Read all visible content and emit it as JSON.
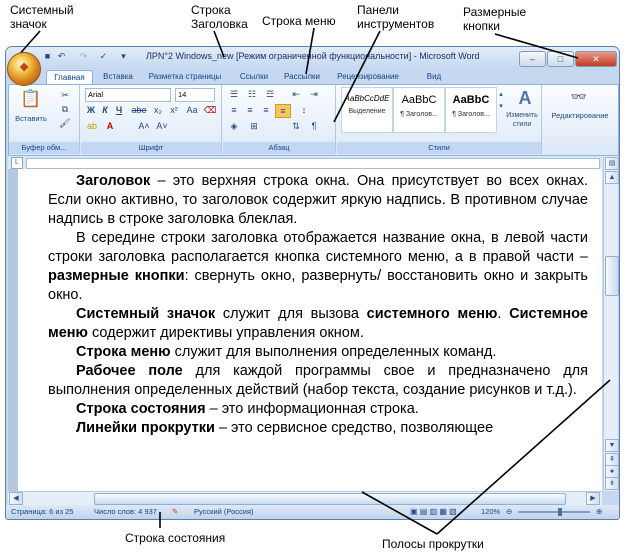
{
  "callouts": {
    "system_icon": "Системный\nзначок",
    "title_bar": "Строка\nЗаголовка",
    "menu_bar": "Строка меню",
    "toolbars": "Панели\nинструментов",
    "size_buttons": "Размерные\nкнопки",
    "status_bar": "Строка состояния",
    "scrollbars": "Полосы прокрутки"
  },
  "window": {
    "title": "ЛРN°2 Windows_new [Режим ограниченной функциональности] - Microsoft Word",
    "buttons": {
      "minimize": "–",
      "maximize": "□",
      "close": "✕"
    }
  },
  "tabs": [
    "Главная",
    "Вставка",
    "Разметка страницы",
    "Ссылки",
    "Рассылки",
    "Рецензирование",
    "Вид"
  ],
  "ribbon": {
    "clipboard": {
      "paste_label": "Вставить",
      "group_label": "Буфер обм..."
    },
    "font": {
      "font_name": "Arial",
      "font_size": "14",
      "group_label": "Шрифт"
    },
    "paragraph": {
      "group_label": "Абзац"
    },
    "styles": {
      "items": [
        {
          "sample": "AaBbCcDdE",
          "name": "Выделение"
        },
        {
          "sample": "AaBbC",
          "name": "¶ Заголов..."
        },
        {
          "sample": "AaBbC",
          "name": "¶ Заголов..."
        }
      ],
      "change_label": "Изменить стили",
      "group_label": "Стили"
    },
    "editing": {
      "label": "Редактирование"
    }
  },
  "document": {
    "paragraphs": [
      {
        "bold": "Заголовок",
        "text": " – это верхняя строка окна. Она присутствует во всех окнах. Если окно активно, то заголовок содержит яркую надпись. В противном случае надпись в строке заголовка блеклая."
      },
      {
        "bold": "",
        "text": "В середине строки заголовка отображается название окна, в левой части строки заголовка располагается кнопка системного меню, а в правой части – ",
        "bold2": "размерные кнопки",
        "text2": ": свернуть окно, развернуть/ восстановить окно и закрыть окно."
      },
      {
        "bold": "Системный значок",
        "text": " служит для вызова ",
        "bold2": "системного меню",
        "text2": ". ",
        "bold3": "Системное меню",
        "text3": " содержит директивы управления окном."
      },
      {
        "bold": "Строка меню",
        "text": " служит для выполнения определенных команд."
      },
      {
        "bold": "Рабочее поле",
        "text": " для каждой программы свое и предназначено для выполнения определенных действий (набор текста, создание рисунков и т.д.)."
      },
      {
        "bold": "Строка состояния",
        "text": " – это информационная строка."
      },
      {
        "bold": "Линейки прокрутки",
        "text": " – это сервисное средство, позволяющее"
      }
    ]
  },
  "status": {
    "page": "Страница: 6 из 25",
    "words": "Число слов: 4 937",
    "language": "Русский (Россия)",
    "zoom": "120%"
  }
}
